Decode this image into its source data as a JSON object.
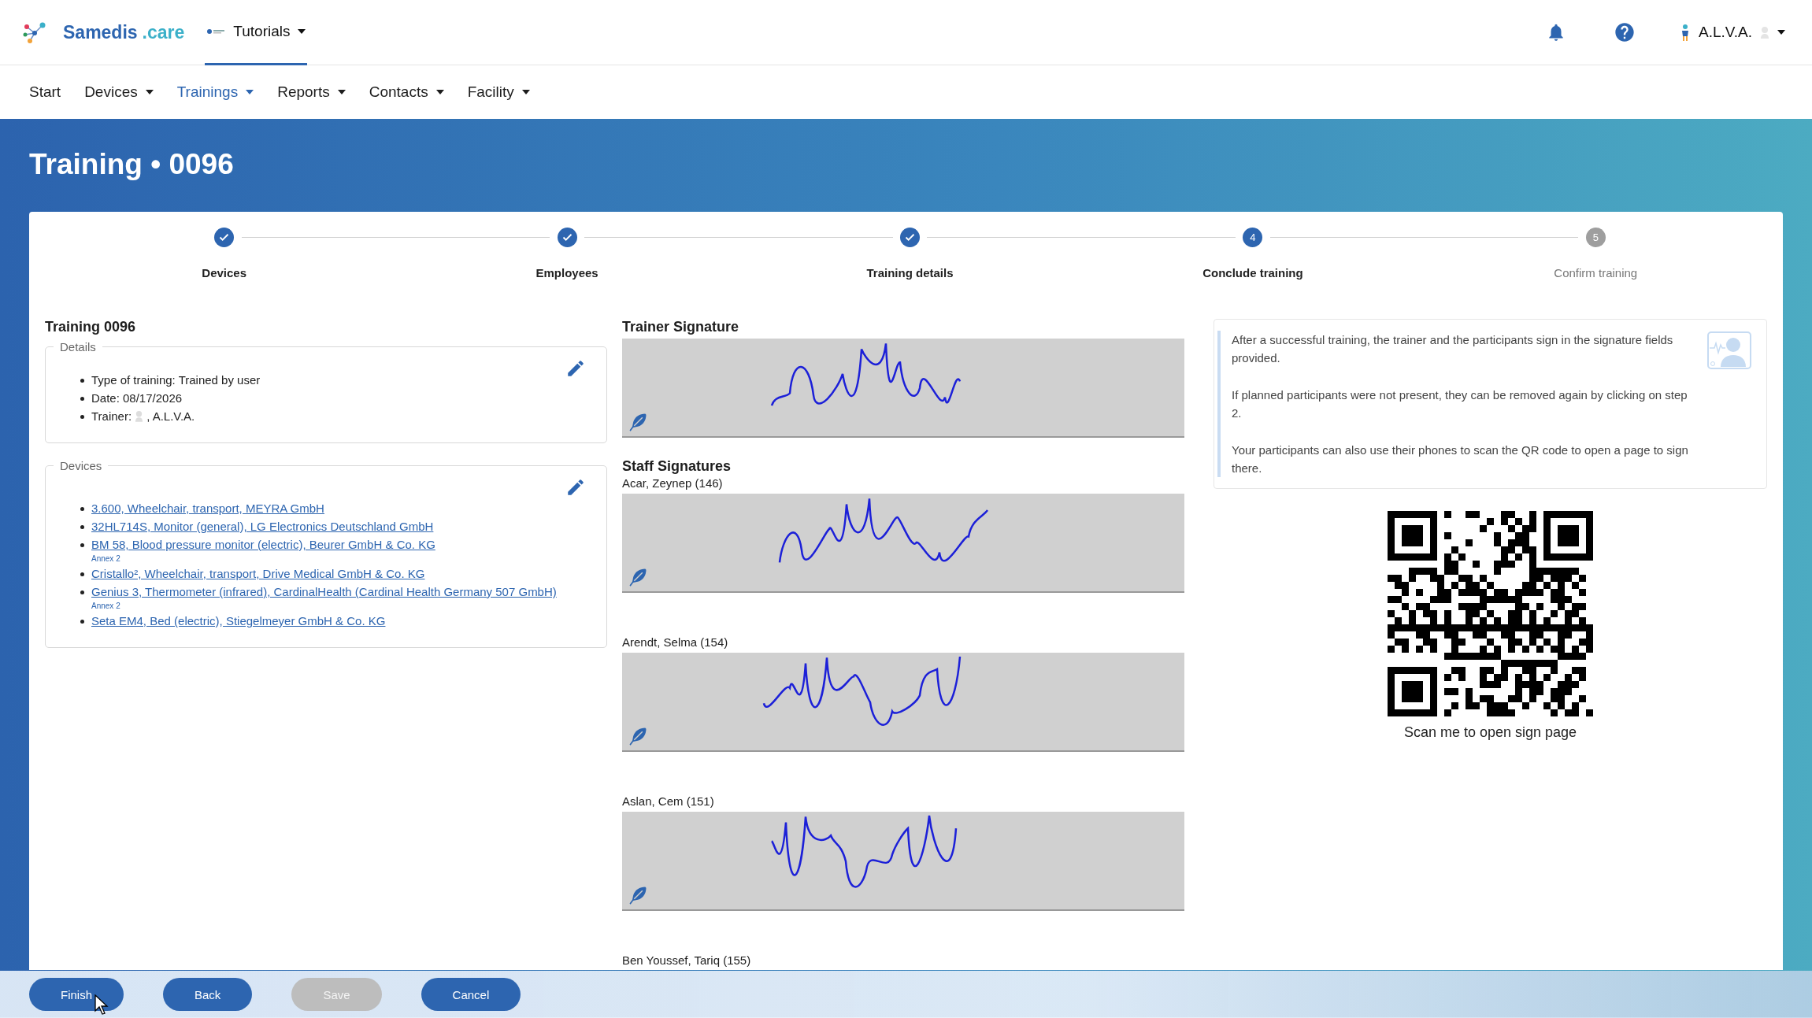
{
  "header": {
    "logo": {
      "name": "Samedis",
      "suffix": ".care"
    },
    "tenant": "Tutorials",
    "user": "A.L.V.A."
  },
  "nav": [
    {
      "label": "Start",
      "dropdown": false,
      "selected": false
    },
    {
      "label": "Devices",
      "dropdown": true,
      "selected": false
    },
    {
      "label": "Trainings",
      "dropdown": true,
      "selected": true
    },
    {
      "label": "Reports",
      "dropdown": true,
      "selected": false
    },
    {
      "label": "Contacts",
      "dropdown": true,
      "selected": false
    },
    {
      "label": "Facility",
      "dropdown": true,
      "selected": false
    }
  ],
  "page_title": "Training • 0096",
  "steps": [
    {
      "label": "Devices",
      "completed": true,
      "reached": true
    },
    {
      "label": "Employees",
      "completed": true,
      "reached": true
    },
    {
      "label": "Training details",
      "completed": true,
      "reached": true
    },
    {
      "label": "Conclude training",
      "completed": false,
      "reached": true,
      "number": "4"
    },
    {
      "label": "Confirm training",
      "completed": false,
      "reached": false,
      "number": "5"
    }
  ],
  "training": {
    "title": "Training 0096",
    "details": {
      "legend": "Details",
      "items": [
        {
          "kind": "text",
          "text": "Type of training: Trained by user"
        },
        {
          "kind": "text",
          "text": "Date: 08/17/2026"
        },
        {
          "kind": "person",
          "label": "Trainer:",
          "name": ", A.L.V.A."
        }
      ]
    },
    "devices": {
      "legend": "Devices",
      "items": [
        {
          "text": "3.600, Wheelchair, transport, MEYRA GmbH"
        },
        {
          "text": "32HL714S, Monitor (general), LG Electronics Deutschland GmbH"
        },
        {
          "text": "BM 58, Blood pressure monitor (electric), Beurer GmbH & Co. KG",
          "note": "Annex 2"
        },
        {
          "text": "Cristallo², Wheelchair, transport, Drive Medical GmbH & Co. KG"
        },
        {
          "text": "Genius 3, Thermometer (infrared), CardinalHealth (Cardinal Health Germany 507 GmbH)",
          "note": "Annex 2"
        },
        {
          "text": "Seta EM4, Bed (electric), Stiegelmeyer GmbH & Co. KG"
        }
      ]
    }
  },
  "signatures": {
    "trainer_title": "Trainer Signature",
    "staff_title": "Staff Signatures",
    "staff": [
      {
        "name": "Acar, Zeynep (146)"
      },
      {
        "name": "Arendt, Selma (154)"
      },
      {
        "name": "Aslan, Cem (151)"
      },
      {
        "name": "Ben Youssef, Tariq (155)"
      }
    ]
  },
  "info": {
    "paragraphs": [
      "After a successful training, the trainer and the participants sign in the signature fields provided.",
      "If planned participants were not present, they can be removed again by clicking on step 2.",
      "Your participants can also use their phones to scan the QR code to open a page to sign there."
    ],
    "qr_caption": "Scan me to open sign page"
  },
  "buttons": [
    {
      "label": "Finish",
      "disabled": false
    },
    {
      "label": "Back",
      "disabled": false
    },
    {
      "label": "Save",
      "disabled": true
    },
    {
      "label": "Cancel",
      "disabled": false
    }
  ]
}
